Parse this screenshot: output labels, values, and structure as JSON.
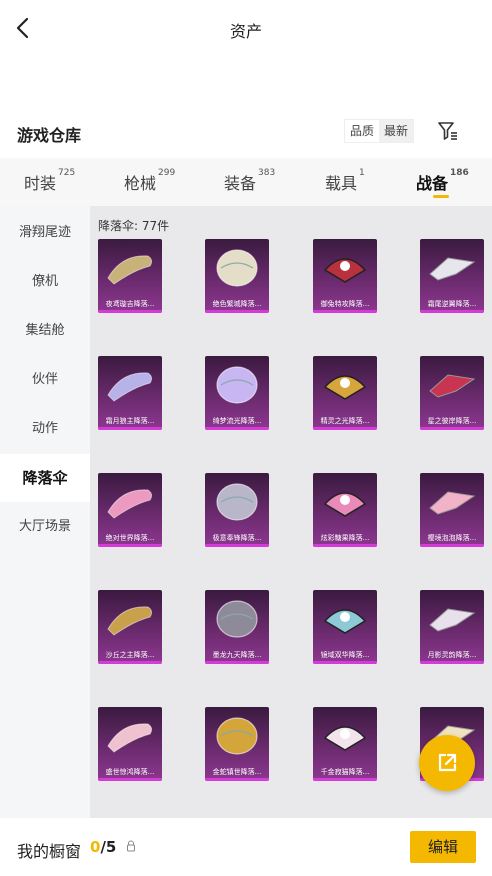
{
  "header": {
    "title": "资产",
    "back_icon": "chevron-left-icon"
  },
  "warehouse": {
    "title": "游戏仓库",
    "sort_options": [
      "品质",
      "最新"
    ],
    "sort_active": "品质",
    "filter_icon": "filter-icon"
  },
  "tabs": [
    {
      "label": "时装",
      "count": "725"
    },
    {
      "label": "枪械",
      "count": "299"
    },
    {
      "label": "装备",
      "count": "383"
    },
    {
      "label": "载具",
      "count": "1"
    },
    {
      "label": "战备",
      "count": "186",
      "active": true
    }
  ],
  "sidebar": {
    "items": [
      {
        "label": "滑翔尾迹"
      },
      {
        "label": "僚机"
      },
      {
        "label": "集结舱"
      },
      {
        "label": "伙伴"
      },
      {
        "label": "动作"
      },
      {
        "label": "降落伞",
        "active": true
      },
      {
        "label": "大厅场景"
      }
    ]
  },
  "content": {
    "count_label": "降落伞: 77件",
    "items": [
      {
        "name": "夜鸢璇吉降落...",
        "color": "#c9b27a"
      },
      {
        "name": "绝色繁城降落...",
        "color": "#e4ddc8"
      },
      {
        "name": "御兔特攻降落...",
        "color": "#b8323d"
      },
      {
        "name": "霜尾逆翼降落...",
        "color": "#e6e6ec"
      },
      {
        "name": "霜月狼主降落...",
        "color": "#b7b3e8"
      },
      {
        "name": "绮梦流光降落...",
        "color": "#c7b6f2"
      },
      {
        "name": "精灵之光降落...",
        "color": "#d8a43c"
      },
      {
        "name": "星之彼岸降落...",
        "color": "#c83451"
      },
      {
        "name": "绝对世界降落...",
        "color": "#ec9ac0"
      },
      {
        "name": "极意奉锋降落...",
        "color": "#b8b6c8"
      },
      {
        "name": "炫彩糖果降落...",
        "color": "#e98ab9"
      },
      {
        "name": "樱境泡泡降落...",
        "color": "#f2b2c8"
      },
      {
        "name": "沙丘之主降落...",
        "color": "#c9a04c"
      },
      {
        "name": "墨龙九天降落...",
        "color": "#8f8a9a"
      },
      {
        "name": "镜域双华降落...",
        "color": "#8ec9d8"
      },
      {
        "name": "月影灵韵降落...",
        "color": "#e8e0ea"
      },
      {
        "name": "盛世惊鸿降落...",
        "color": "#f0c2cf"
      },
      {
        "name": "金蛇镇世降落...",
        "color": "#d4a53a"
      },
      {
        "name": "千金寂猫降落...",
        "color": "#f3e4ec"
      },
      {
        "name": "",
        "color": "#f0e4c0"
      }
    ]
  },
  "share_button": {
    "icon": "share-icon"
  },
  "footer": {
    "showcase_label": "我的橱窗",
    "showcase_current": "0",
    "showcase_total": "/5",
    "lock_icon": "lock-icon",
    "edit_label": "编辑"
  },
  "colors": {
    "accent": "#f5b800",
    "card_bg": "#6a2a6d",
    "card_border": "#d43bd9"
  }
}
